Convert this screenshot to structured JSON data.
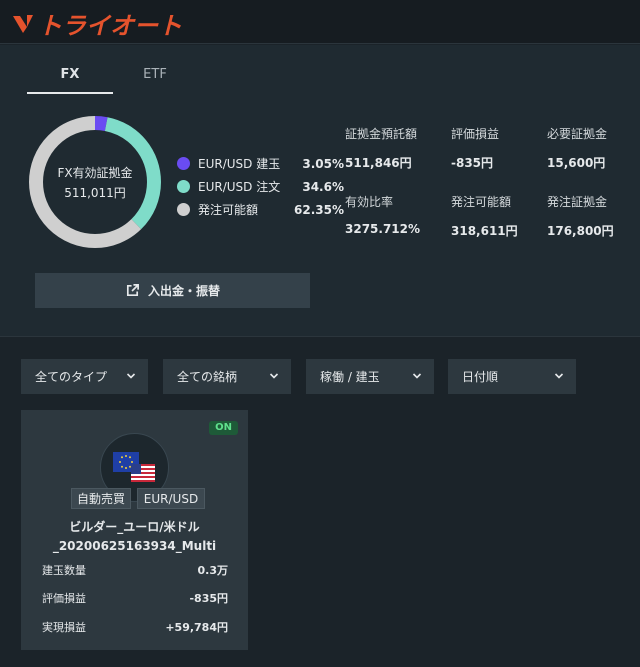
{
  "header": {
    "logo_text": "トライオート"
  },
  "tabs": [
    {
      "label": "FX"
    },
    {
      "label": "ETF"
    }
  ],
  "summary": {
    "center_label": "FX有効証拠金",
    "center_value": "511,011円",
    "legend": [
      {
        "label": "EUR/USD 建玉",
        "value": "3.05%",
        "color": "#6a4cf2",
        "fraction": 0.0305
      },
      {
        "label": "EUR/USD 注文",
        "value": "34.6%",
        "color": "#7fdcc9",
        "fraction": 0.346
      },
      {
        "label": "発注可能額",
        "value": "62.35%",
        "color": "#cfcfcf",
        "fraction": 0.6235
      }
    ],
    "metrics": [
      {
        "label": "証拠金預託額",
        "value": "511,846円"
      },
      {
        "label": "評価損益",
        "value": "-835円"
      },
      {
        "label": "必要証拠金",
        "value": "15,600円"
      },
      {
        "label": "有効比率",
        "value": "3275.712%"
      },
      {
        "label": "発注可能額",
        "value": "318,611円"
      },
      {
        "label": "発注証拠金",
        "value": "176,800円"
      }
    ],
    "deposit_button": "入出金・振替"
  },
  "filters": [
    {
      "label": "全てのタイプ"
    },
    {
      "label": "全ての銘柄"
    },
    {
      "label": "稼働 / 建玉"
    },
    {
      "label": "日付順"
    }
  ],
  "card": {
    "status": "ON",
    "tag_auto": "自動売買",
    "tag_pair": "EUR/USD",
    "title_line1": "ビルダー_ユーロ/米ドル",
    "title_line2": "_20200625163934_Multi",
    "rows": [
      {
        "label": "建玉数量",
        "value": "0.3万"
      },
      {
        "label": "評価損益",
        "value": "-835円"
      },
      {
        "label": "実現損益",
        "value": "+59,784円"
      }
    ]
  }
}
